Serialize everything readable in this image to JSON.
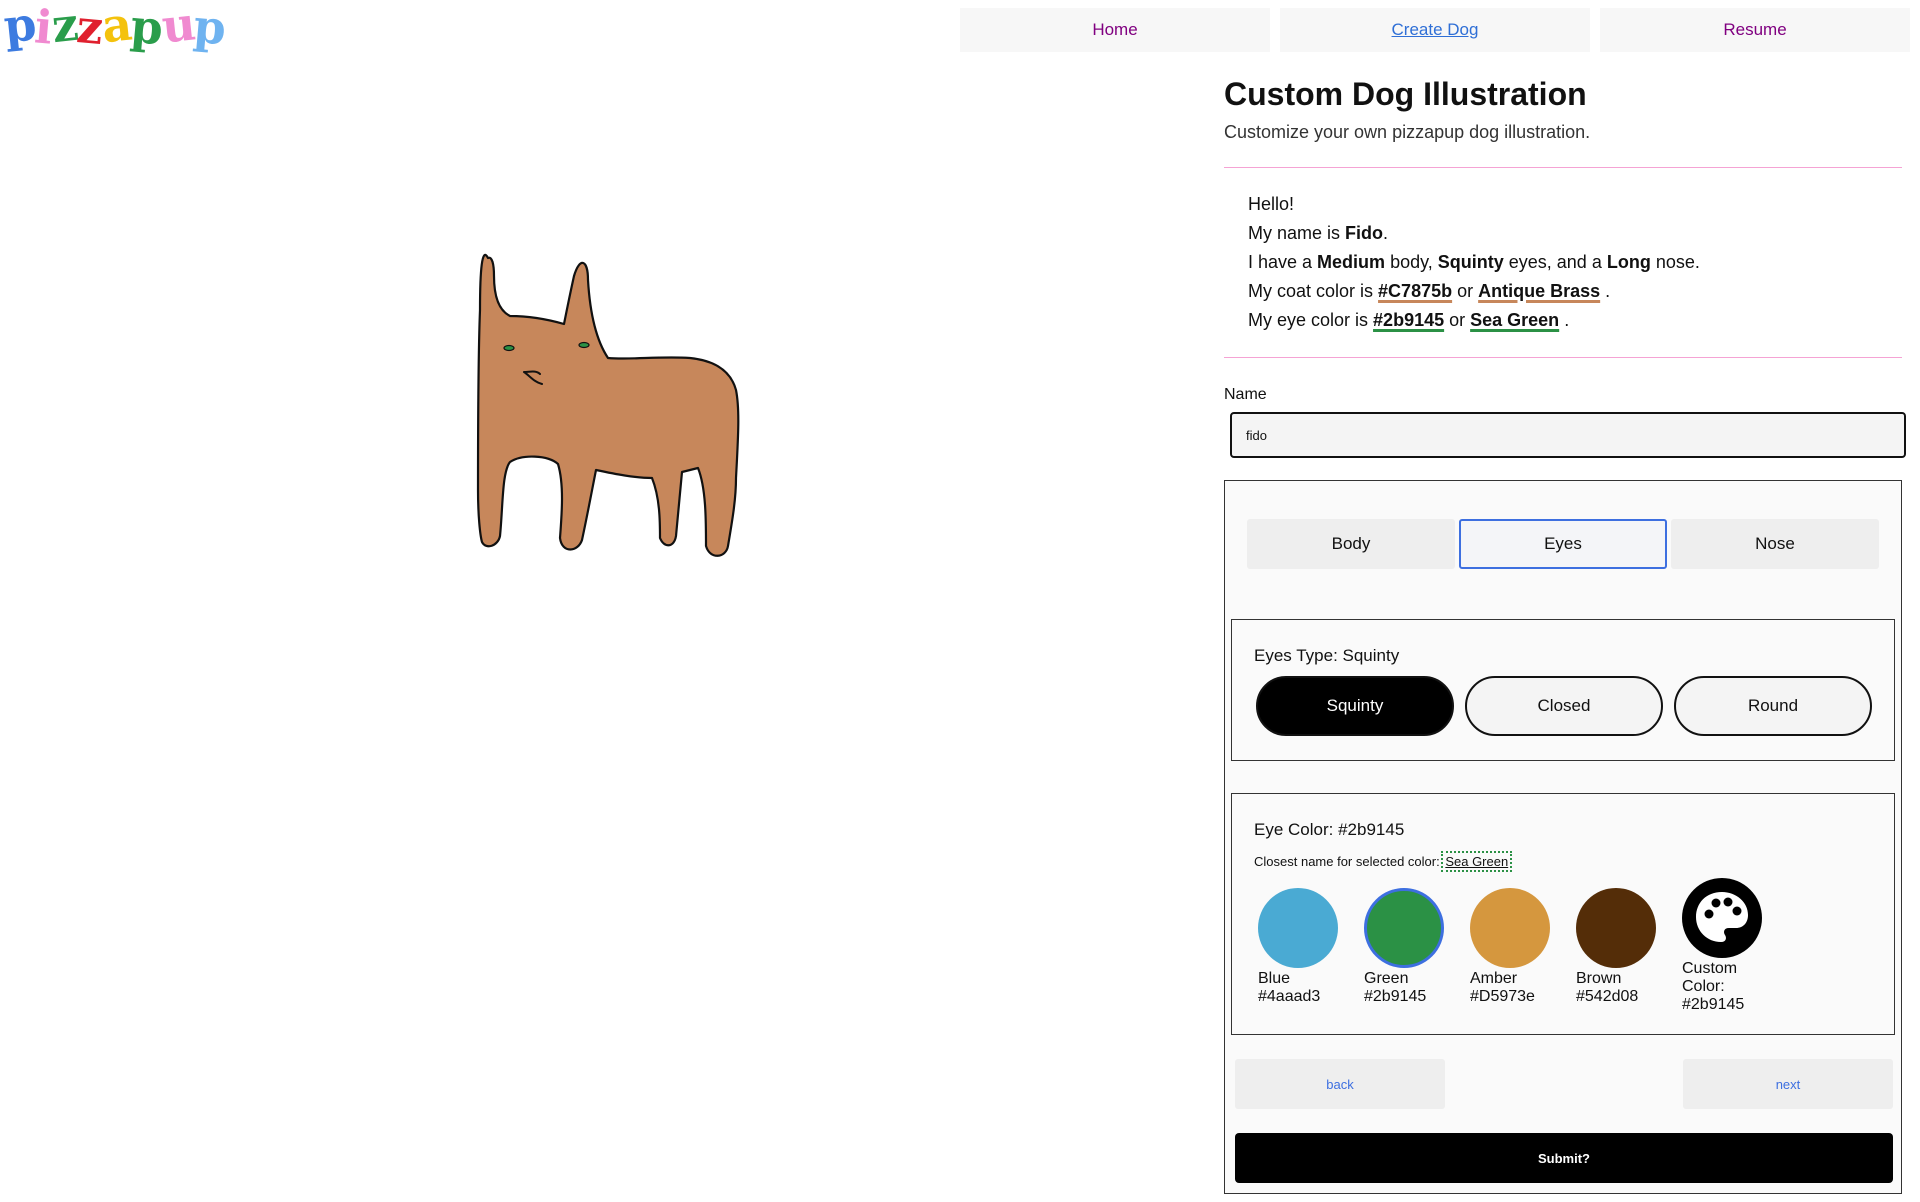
{
  "logo": {
    "letters": [
      "p",
      "i",
      "z",
      "z",
      "a",
      "p",
      "u",
      "p"
    ],
    "colors": [
      "#3d7be0",
      "#f08ad0",
      "#2a9d4b",
      "#e0202e",
      "#f4c20d",
      "#2a9d4b",
      "#f08ad0",
      "#6fb3f0"
    ]
  },
  "nav": {
    "home": "Home",
    "create": "Create Dog",
    "resume": "Resume"
  },
  "page": {
    "title": "Custom Dog Illustration",
    "subtitle": "Customize your own pizzapup dog illustration."
  },
  "intro": {
    "hello": "Hello!",
    "name_prefix": "My name is ",
    "name": "Fido",
    "name_suffix": ".",
    "have_prefix": "I have a ",
    "body": "Medium",
    "body_suffix": " body, ",
    "eyes": "Squinty",
    "eyes_suffix": " eyes, and a ",
    "nose": "Long",
    "nose_suffix": " nose.",
    "coat_prefix": "My coat color is ",
    "coat_hex": "#C7875b",
    "or1": " or ",
    "coat_name": "Antique Brass",
    "coat_suffix": " .",
    "eye_prefix": "My eye color is ",
    "eye_hex": "#2b9145",
    "or2": " or ",
    "eye_name": "Sea Green",
    "eye_suffix": " ."
  },
  "colors": {
    "coat": "#C7875b",
    "eye": "#2b9145",
    "accent": "#3d6fe0",
    "divider": "#f5a3d4"
  },
  "form": {
    "name_label": "Name",
    "name_value": "fido",
    "tabs": [
      "Body",
      "Eyes",
      "Nose"
    ],
    "active_tab": "Eyes",
    "eyes_type_label": "Eyes Type: Squinty",
    "eye_options": [
      "Squinty",
      "Closed",
      "Round"
    ],
    "selected_eye": "Squinty",
    "eye_color_label": "Eye Color: #2b9145",
    "closest_label": "Closest name for selected color:",
    "closest_name": "Sea Green",
    "swatches": [
      {
        "name": "Blue",
        "hex": "#4aaad3"
      },
      {
        "name": "Green",
        "hex": "#2b9145"
      },
      {
        "name": "Amber",
        "hex": "#D5973e"
      },
      {
        "name": "Brown",
        "hex": "#542d08"
      }
    ],
    "selected_swatch": "Green",
    "custom_label": "Custom Color:",
    "custom_hex": "#2b9145",
    "back": "back",
    "next": "next",
    "submit": "Submit?"
  }
}
